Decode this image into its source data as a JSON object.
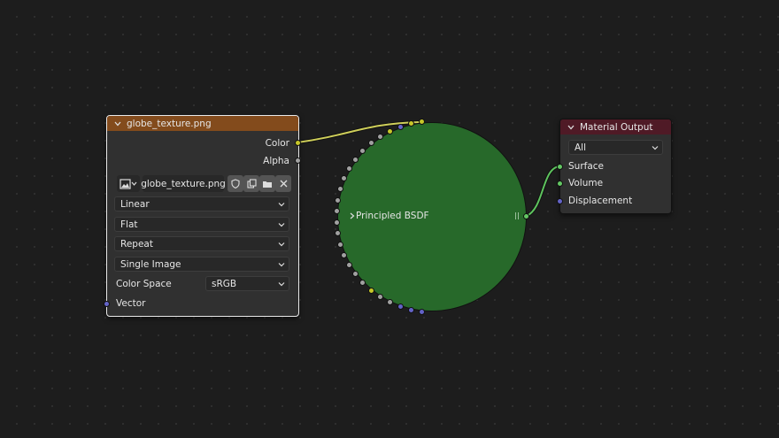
{
  "image_node": {
    "title": "globe_texture.png",
    "outputs": {
      "color": "Color",
      "alpha": "Alpha"
    },
    "image_name": "globe_texture.png",
    "interpolation": "Linear",
    "projection": "Flat",
    "extension": "Repeat",
    "source": "Single Image",
    "color_space_label": "Color Space",
    "color_space_value": "sRGB",
    "vector_input": "Vector",
    "header_color": "#834b1c"
  },
  "bsdf_node": {
    "title": "Principled BSDF",
    "body_color": "#27692a"
  },
  "output_node": {
    "title": "Material Output",
    "target": "All",
    "inputs": {
      "surface": "Surface",
      "volume": "Volume",
      "displacement": "Displacement"
    },
    "header_color": "#4f1a26"
  },
  "colors": {
    "socket_color": "#c7c729",
    "socket_shader": "#63c763",
    "socket_vector": "#6363c7",
    "socket_float": "#a1a1a1",
    "wire_color": "#cfcf5a",
    "wire_shader": "#5ec45e"
  }
}
